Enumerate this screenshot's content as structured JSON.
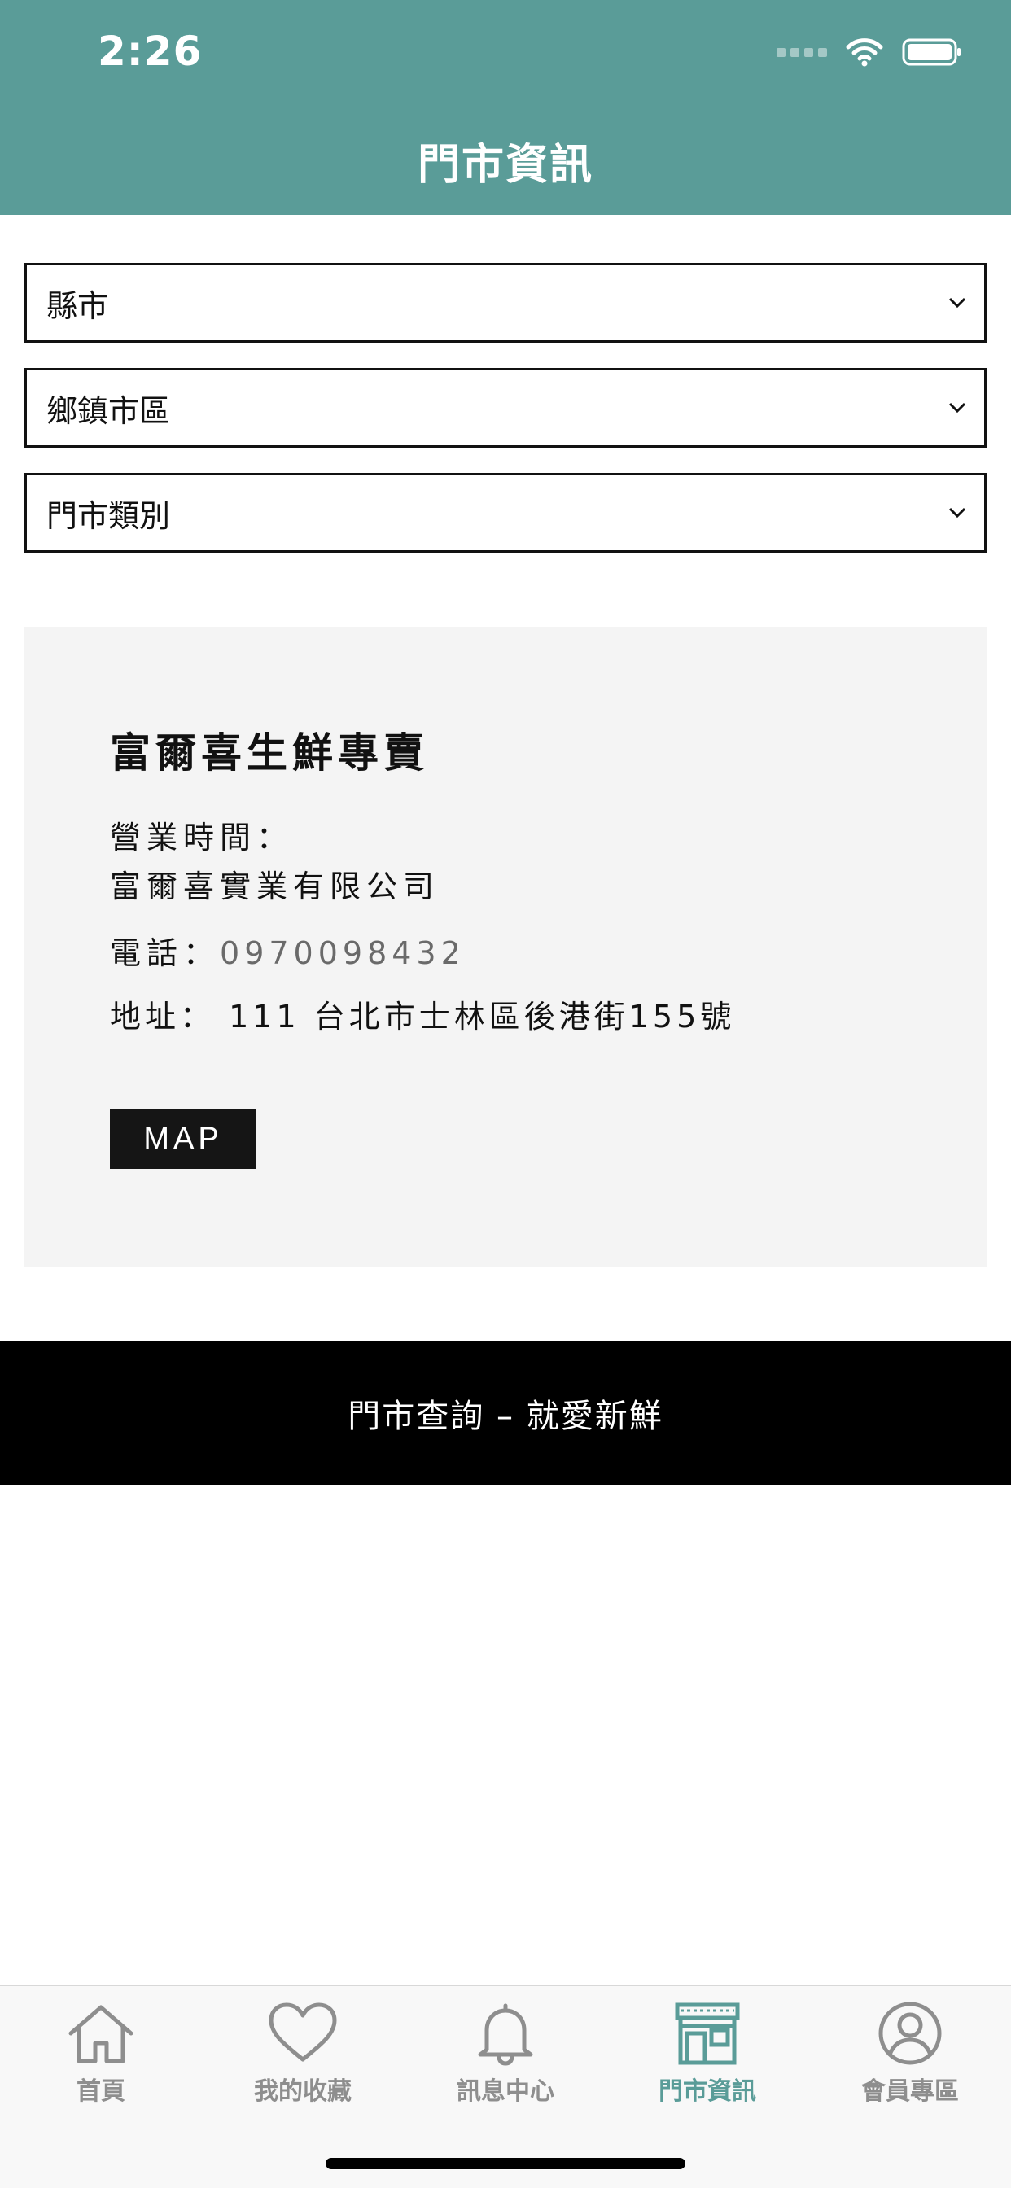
{
  "status_bar": {
    "time": "2:26"
  },
  "header": {
    "title": "門市資訊"
  },
  "filters": [
    {
      "label": "縣市"
    },
    {
      "label": "鄉鎮市區"
    },
    {
      "label": "門市類別"
    }
  ],
  "store": {
    "name": "富爾喜生鮮專賣",
    "hours_label": "營業時間：",
    "hours_value": "富爾喜實業有限公司",
    "phone_label": "電話：",
    "phone": "0970098432",
    "address_label": "地址：",
    "address": "111 台北市士林區後港街155號",
    "map_button": "MAP"
  },
  "banner": {
    "text": "門市查詢 – 就愛新鮮"
  },
  "tabbar": {
    "items": [
      {
        "label": "首頁",
        "icon": "home-icon",
        "active": false
      },
      {
        "label": "我的收藏",
        "icon": "heart-icon",
        "active": false
      },
      {
        "label": "訊息中心",
        "icon": "bell-icon",
        "active": false
      },
      {
        "label": "門市資訊",
        "icon": "store-icon",
        "active": true
      },
      {
        "label": "會員專區",
        "icon": "user-icon",
        "active": false
      }
    ],
    "active_color": "#5a9c98",
    "inactive_color": "#8e8e8e"
  },
  "colors": {
    "header_bg": "#5a9c98",
    "banner_bg": "#000000",
    "card_bg": "#f4f4f4"
  }
}
